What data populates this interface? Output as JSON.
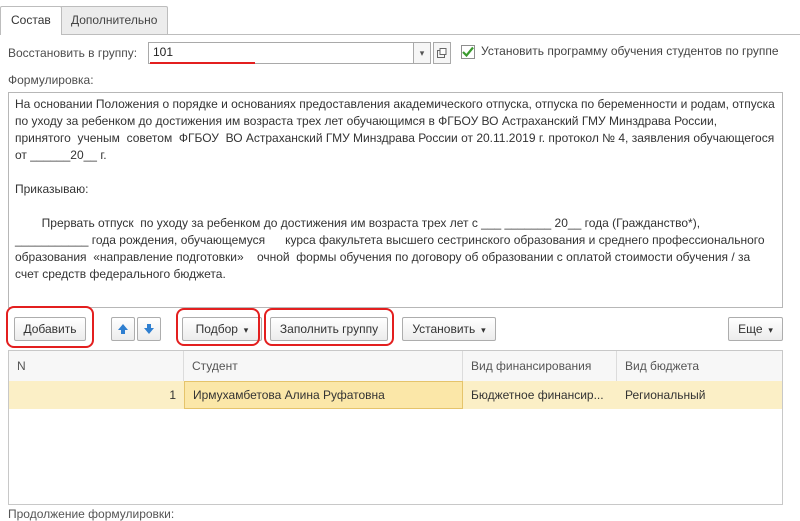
{
  "tabs": [
    {
      "label": "Состав",
      "active": true
    },
    {
      "label": "Дополнительно",
      "active": false
    }
  ],
  "group_field": {
    "label": "Восстановить в группу:",
    "value": "101"
  },
  "program_checkbox": {
    "checked": true,
    "label": "Установить программу обучения студентов по группе"
  },
  "formulation": {
    "label": "Формулировка:",
    "paragraphs": [
      "На основании Положения о порядке и основаниях предоставления академического отпуска, отпуска по беременности и родам, отпуска по уходу за ребенком до достижения им возраста трех лет обучающимся в ФГБОУ ВО Астраханский ГМУ Минздрава России, принятого  ученым  советом  ФГБОУ  ВО Астраханский ГМУ Минздрава России от 20.11.2019 г. протокол № 4, заявления обучающегося от ______20__ г.",
      "",
      "Приказываю:",
      "",
      "        Прервать отпуск  по уходу за ребенком до достижения им возраста трех лет с ___ _______ 20__ года (Гражданство*), ___________ года рождения, обучающемуся      курса факультета высшего сестринского образования и среднего профессионального образования  «направление подготовки»    очной  формы обучения по договору об образовании с оплатой стоимости обучения / за счет средств федерального бюджета."
    ]
  },
  "toolbar": {
    "add": "Добавить",
    "select": "Подбор",
    "fill_group": "Заполнить группу",
    "set": "Установить",
    "more": "Еще"
  },
  "table": {
    "columns": [
      "N",
      "Студент",
      "Вид финансирования",
      "Вид бюджета"
    ],
    "rows": [
      {
        "n": "1",
        "student": "Ирмухамбетова Алина Руфатовна",
        "financing": "Бюджетное финансир...",
        "budget": "Региональный"
      }
    ]
  },
  "bottom_label": "Продолжение формулировки:",
  "colors": {
    "annotation": "#e31f1f",
    "checkbox": "#3a9a2e",
    "arrow": "#2f7fd0",
    "selected_row": "#fbefc6"
  }
}
